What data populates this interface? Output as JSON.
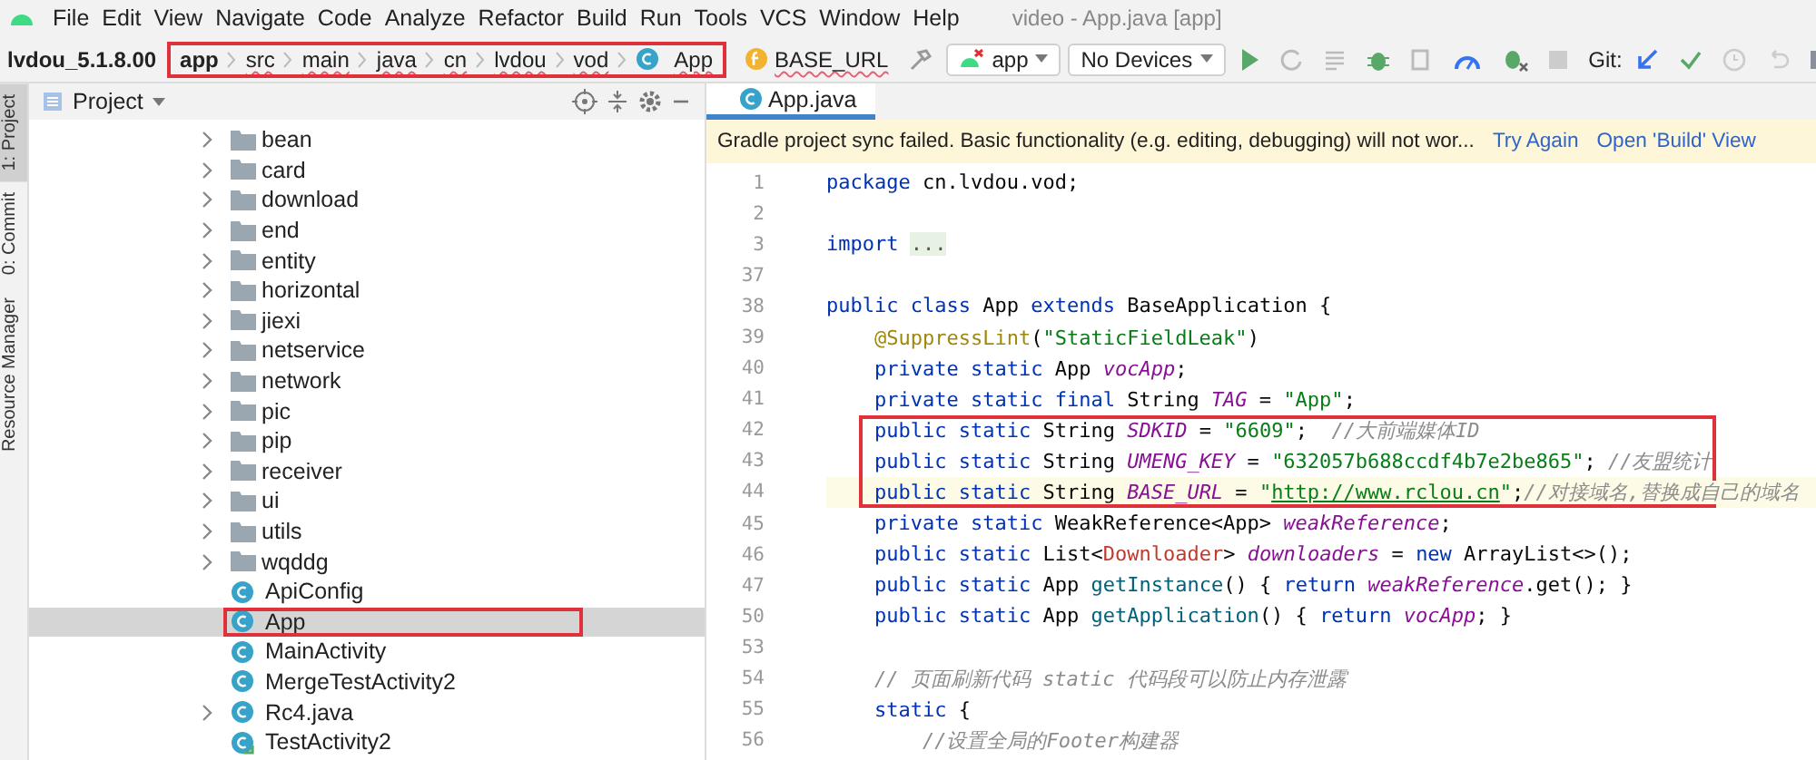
{
  "menu": [
    "File",
    "Edit",
    "View",
    "Navigate",
    "Code",
    "Analyze",
    "Refactor",
    "Build",
    "Run",
    "Tools",
    "VCS",
    "Window",
    "Help"
  ],
  "window": {
    "title": "video - App.java [app]"
  },
  "navbar": {
    "project": "lvdou_5.1.8.00",
    "annotated": true,
    "crumbs": [
      {
        "label": "app",
        "kind": "module"
      },
      {
        "label": "src",
        "kind": "dir"
      },
      {
        "label": "main",
        "kind": "dir"
      },
      {
        "label": "java",
        "kind": "dir"
      },
      {
        "label": "cn",
        "kind": "dir"
      },
      {
        "label": "lvdou",
        "kind": "dir"
      },
      {
        "label": "vod",
        "kind": "dir"
      },
      {
        "label": "App",
        "kind": "class"
      }
    ],
    "member": "BASE_URL"
  },
  "toolbar": {
    "run_config": "app",
    "device": "No Devices",
    "git_label": "Git:"
  },
  "side_tabs": [
    {
      "label": "1: Project",
      "selected": true
    },
    {
      "label": "0: Commit",
      "selected": false
    },
    {
      "label": "Resource Manager",
      "selected": false
    }
  ],
  "project_panel": {
    "title": "Project",
    "items": [
      {
        "label": "bean",
        "kind": "folder",
        "expandable": true,
        "selected": false,
        "annotated": false
      },
      {
        "label": "card",
        "kind": "folder",
        "expandable": true,
        "selected": false,
        "annotated": false
      },
      {
        "label": "download",
        "kind": "folder",
        "expandable": true,
        "selected": false,
        "annotated": false
      },
      {
        "label": "end",
        "kind": "folder",
        "expandable": true,
        "selected": false,
        "annotated": false
      },
      {
        "label": "entity",
        "kind": "folder",
        "expandable": true,
        "selected": false,
        "annotated": false
      },
      {
        "label": "horizontal",
        "kind": "folder",
        "expandable": true,
        "selected": false,
        "annotated": false
      },
      {
        "label": "jiexi",
        "kind": "folder",
        "expandable": true,
        "selected": false,
        "annotated": false
      },
      {
        "label": "netservice",
        "kind": "folder",
        "expandable": true,
        "selected": false,
        "annotated": false
      },
      {
        "label": "network",
        "kind": "folder",
        "expandable": true,
        "selected": false,
        "annotated": false
      },
      {
        "label": "pic",
        "kind": "folder",
        "expandable": true,
        "selected": false,
        "annotated": false
      },
      {
        "label": "pip",
        "kind": "folder",
        "expandable": true,
        "selected": false,
        "annotated": false
      },
      {
        "label": "receiver",
        "kind": "folder",
        "expandable": true,
        "selected": false,
        "annotated": false
      },
      {
        "label": "ui",
        "kind": "folder",
        "expandable": true,
        "selected": false,
        "annotated": false
      },
      {
        "label": "utils",
        "kind": "folder",
        "expandable": true,
        "selected": false,
        "annotated": false
      },
      {
        "label": "wqddg",
        "kind": "folder",
        "expandable": true,
        "selected": false,
        "annotated": false
      },
      {
        "label": "ApiConfig",
        "kind": "class",
        "expandable": false,
        "selected": false,
        "annotated": false
      },
      {
        "label": "App",
        "kind": "class",
        "expandable": false,
        "selected": true,
        "annotated": true
      },
      {
        "label": "MainActivity",
        "kind": "class",
        "expandable": false,
        "selected": false,
        "annotated": false
      },
      {
        "label": "MergeTestActivity2",
        "kind": "class",
        "expandable": false,
        "selected": false,
        "annotated": false
      },
      {
        "label": "Rc4.java",
        "kind": "class",
        "expandable": true,
        "selected": false,
        "annotated": false
      },
      {
        "label": "TestActivity2",
        "kind": "test-class",
        "expandable": false,
        "selected": false,
        "annotated": false
      }
    ]
  },
  "editor": {
    "tabs": [
      {
        "label": "App.java",
        "selected": true
      }
    ],
    "banner": {
      "message": "Gradle project sync failed. Basic functionality (e.g. editing, debugging) will not wor...",
      "actions": [
        "Try Again",
        "Open 'Build' View"
      ]
    },
    "blocks": [
      {
        "annotated": false,
        "lines": [
          {
            "num": "1",
            "current": false,
            "tokens": [
              {
                "text": "package",
                "kind": "kw"
              },
              {
                "text": " cn.lvdou.vod;",
                "kind": "plain"
              }
            ]
          },
          {
            "num": "2",
            "current": false
          },
          {
            "num": "3",
            "current": false,
            "tokens": [
              {
                "text": "import ",
                "kind": "kw"
              },
              {
                "text": "...",
                "kind": "fold"
              }
            ]
          },
          {
            "num": "37",
            "current": false
          },
          {
            "num": "38",
            "current": false,
            "tokens": [
              {
                "text": "public class",
                "kind": "kw"
              },
              {
                "text": " App ",
                "kind": "plain"
              },
              {
                "text": "extends",
                "kind": "kw"
              },
              {
                "text": " BaseApplication {",
                "kind": "plain"
              }
            ]
          },
          {
            "num": "39",
            "current": false,
            "tokens": [
              {
                "text": "    @SuppressLint",
                "kind": "ann"
              },
              {
                "text": "(",
                "kind": "plain"
              },
              {
                "text": "\"StaticFieldLeak\"",
                "kind": "str"
              },
              {
                "text": ")",
                "kind": "plain"
              }
            ]
          },
          {
            "num": "40",
            "current": false,
            "tokens": [
              {
                "text": "    private static",
                "kind": "kw"
              },
              {
                "text": " App ",
                "kind": "plain"
              },
              {
                "text": "vocApp",
                "kind": "field"
              },
              {
                "text": ";",
                "kind": "plain"
              }
            ]
          },
          {
            "num": "41",
            "current": false,
            "tokens": [
              {
                "text": "    private static final",
                "kind": "kw"
              },
              {
                "text": " String ",
                "kind": "plain"
              },
              {
                "text": "TAG",
                "kind": "field"
              },
              {
                "text": " = ",
                "kind": "plain"
              },
              {
                "text": "\"App\"",
                "kind": "str"
              },
              {
                "text": ";",
                "kind": "plain"
              }
            ]
          }
        ]
      },
      {
        "annotated": true,
        "lines": [
          {
            "num": "42",
            "current": false,
            "tokens": [
              {
                "text": "    public static",
                "kind": "kw"
              },
              {
                "text": " String ",
                "kind": "plain"
              },
              {
                "text": "SDKID",
                "kind": "field"
              },
              {
                "text": " = ",
                "kind": "plain"
              },
              {
                "text": "\"6609\"",
                "kind": "str"
              },
              {
                "text": ";  ",
                "kind": "plain"
              },
              {
                "text": "//大前端媒体ID",
                "kind": "comment"
              }
            ]
          },
          {
            "num": "43",
            "current": false,
            "tokens": [
              {
                "text": "    public static",
                "kind": "kw"
              },
              {
                "text": " String ",
                "kind": "plain"
              },
              {
                "text": "UMENG_KEY",
                "kind": "field"
              },
              {
                "text": " = ",
                "kind": "plain"
              },
              {
                "text": "\"632057b688ccdf4b7e2be865\"",
                "kind": "str"
              },
              {
                "text": "; ",
                "kind": "plain"
              },
              {
                "text": "//友盟统计",
                "kind": "comment"
              }
            ]
          },
          {
            "num": "44",
            "current": true,
            "tokens": [
              {
                "text": "    public static",
                "kind": "kw"
              },
              {
                "text": " String ",
                "kind": "plain"
              },
              {
                "text": "BASE_URL",
                "kind": "field"
              },
              {
                "text": " = ",
                "kind": "plain"
              },
              {
                "text": "\"",
                "kind": "str"
              },
              {
                "text": "http://www.rclou.cn",
                "kind": "url"
              },
              {
                "text": "\"",
                "kind": "str"
              },
              {
                "text": ";",
                "kind": "plain"
              },
              {
                "text": "//对接域名,替换成自己的域名",
                "kind": "comment"
              }
            ]
          }
        ]
      },
      {
        "annotated": false,
        "lines": [
          {
            "num": "45",
            "current": false,
            "tokens": [
              {
                "text": "    private static",
                "kind": "kw"
              },
              {
                "text": " WeakReference<App> ",
                "kind": "plain"
              },
              {
                "text": "weakReference",
                "kind": "field"
              },
              {
                "text": ";",
                "kind": "plain"
              }
            ]
          },
          {
            "num": "46",
            "current": false,
            "tokens": [
              {
                "text": "    public static",
                "kind": "kw"
              },
              {
                "text": " List<",
                "kind": "plain"
              },
              {
                "text": "Downloader",
                "kind": "error"
              },
              {
                "text": "> ",
                "kind": "plain"
              },
              {
                "text": "downloaders",
                "kind": "field"
              },
              {
                "text": " = ",
                "kind": "plain"
              },
              {
                "text": "new",
                "kind": "kw"
              },
              {
                "text": " ArrayList<>();",
                "kind": "plain"
              }
            ]
          },
          {
            "num": "47",
            "current": false,
            "tokens": [
              {
                "text": "    public static",
                "kind": "kw"
              },
              {
                "text": " App ",
                "kind": "plain"
              },
              {
                "text": "getInstance",
                "kind": "method"
              },
              {
                "text": "() { ",
                "kind": "plain"
              },
              {
                "text": "return",
                "kind": "kw"
              },
              {
                "text": " weakReference",
                "kind": "field"
              },
              {
                "text": ".get(); }",
                "kind": "plain"
              }
            ]
          },
          {
            "num": "50",
            "current": false,
            "tokens": [
              {
                "text": "    public static",
                "kind": "kw"
              },
              {
                "text": " App ",
                "kind": "plain"
              },
              {
                "text": "getApplication",
                "kind": "method"
              },
              {
                "text": "() { ",
                "kind": "plain"
              },
              {
                "text": "return",
                "kind": "kw"
              },
              {
                "text": " vocApp",
                "kind": "field"
              },
              {
                "text": "; }",
                "kind": "plain"
              }
            ]
          },
          {
            "num": "53",
            "current": false
          },
          {
            "num": "54",
            "current": false,
            "tokens": [
              {
                "text": "    // 页面刷新代码 static 代码段可以防止内存泄露",
                "kind": "comment"
              }
            ]
          },
          {
            "num": "55",
            "current": false,
            "tokens": [
              {
                "text": "    static",
                "kind": "kw"
              },
              {
                "text": " {",
                "kind": "plain"
              }
            ]
          },
          {
            "num": "56",
            "current": false,
            "tokens": [
              {
                "text": "        //设置全局的Footer构建器",
                "kind": "comment"
              }
            ]
          }
        ]
      }
    ]
  }
}
